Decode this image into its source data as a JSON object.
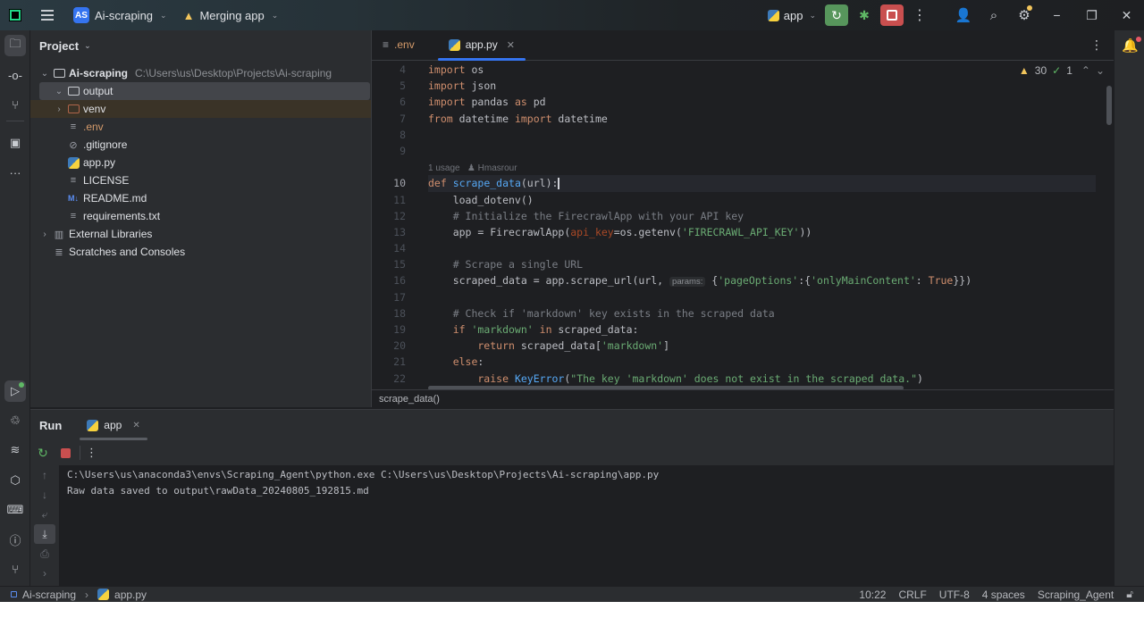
{
  "titlebar": {
    "project_badge": "AS",
    "project_name": "Ai-scraping",
    "vcs_label": "Merging app",
    "run_config": "app"
  },
  "sidebar": {
    "header": "Project",
    "tree": [
      {
        "label": "Ai-scraping",
        "path": "C:\\Users\\us\\Desktop\\Projects\\Ai-scraping"
      },
      {
        "label": "output"
      },
      {
        "label": "venv"
      },
      {
        "label": ".env"
      },
      {
        "label": ".gitignore"
      },
      {
        "label": "app.py"
      },
      {
        "label": "LICENSE"
      },
      {
        "label": "README.md",
        "badge": "M↓"
      },
      {
        "label": "requirements.txt"
      },
      {
        "label": "External Libraries"
      },
      {
        "label": "Scratches and Consoles"
      }
    ]
  },
  "editor": {
    "tabs": [
      {
        "label": ".env"
      },
      {
        "label": "app.py",
        "active": true
      }
    ],
    "inspection": {
      "warnings": "30",
      "ok": "1"
    },
    "usage_hint": "1 usage",
    "author_hint": "Hmasrour",
    "param_hint": "params:",
    "line_numbers": [
      "4",
      "5",
      "6",
      "7",
      "8",
      "9",
      "10",
      "11",
      "12",
      "13",
      "14",
      "15",
      "16",
      "17",
      "18",
      "19",
      "20",
      "21",
      "22"
    ],
    "breadcrumb": "scrape_data()"
  },
  "run_panel": {
    "title": "Run",
    "tab": "app",
    "output": [
      "C:\\Users\\us\\anaconda3\\envs\\Scraping_Agent\\python.exe C:\\Users\\us\\Desktop\\Projects\\Ai-scraping\\app.py",
      "Raw data saved to output\\rawData_20240805_192815.md"
    ]
  },
  "statusbar": {
    "project": "Ai-scraping",
    "file": "app.py",
    "position": "10:22",
    "line_sep": "CRLF",
    "encoding": "UTF-8",
    "indent": "4 spaces",
    "interpreter": "Scraping_Agent"
  },
  "colors": {
    "accent": "#3574f0",
    "run_green": "#57965c",
    "stop_red": "#c94f4f",
    "warning": "#f2c55c"
  }
}
